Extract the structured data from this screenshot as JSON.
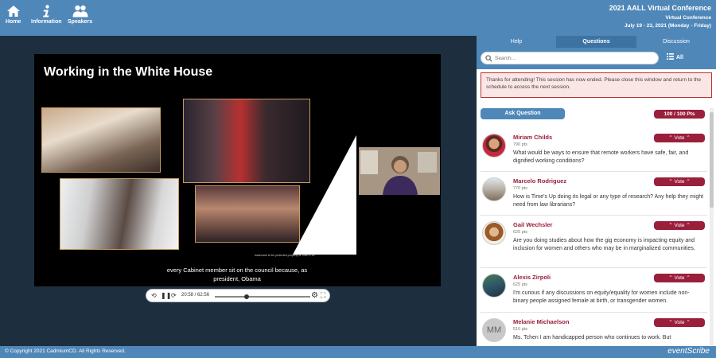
{
  "header": {
    "nav": [
      {
        "label": "Home",
        "icon": "home-icon"
      },
      {
        "label": "Information",
        "icon": "info-icon"
      },
      {
        "label": "Speakers",
        "icon": "speakers-icon"
      }
    ],
    "conference_title": "2021 AALL Virtual Conference",
    "conference_subtitle": "Virtual Conference",
    "conference_dates": "July 19 - 23, 2021 (Monday - Friday)"
  },
  "video": {
    "slide_title": "Working in the White House",
    "slide_credit": "trademark is the protected property of TIME'S UP",
    "caption": "every Cabinet member sit on the council because, as president, Obama",
    "current_time": "20:58",
    "duration": "62:56",
    "progress_fraction": 0.33
  },
  "panel": {
    "tabs": [
      {
        "label": "Help",
        "active": false
      },
      {
        "label": "Questions",
        "active": true
      },
      {
        "label": "Discussion",
        "active": false
      }
    ],
    "search_placeholder": "Search...",
    "filter_label": "All",
    "notice": "Thanks for attending! This session has now ended. Please close this window and return to the schedule to access the next session.",
    "ask_label": "Ask Question",
    "points_label": "100 / 100  Pts",
    "vote_label": "Vote",
    "questions": [
      {
        "name": "Miriam Childs",
        "pts": "790 pts",
        "text": "What would be ways to ensure that remote workers have safe, fair, and dignified working conditions?"
      },
      {
        "name": "Marcelo Rodriguez",
        "pts": "770 pts",
        "text": "How is Time's Up doing its legal or any type of research? Any help they might need from law librarians?"
      },
      {
        "name": "Gail Wechsler",
        "pts": "625 pts",
        "text": "Are you doing studies about how the gig economy is impacting equity and inclusion for women and others who may be in marginalized communities."
      },
      {
        "name": "Alexis Zirpoli",
        "pts": "625 pts",
        "text": "I'm curious if any discussions on equity/equality for women include non-binary people assigned female at birth, or transgender women."
      },
      {
        "name": "Melanie Michaelson",
        "pts": "510 pts",
        "text": "Ms. Tchen I am handicapped person who continues to work. But",
        "initials": "MM"
      }
    ]
  },
  "footer": {
    "copyright": "© Copyright 2021 CadmiumCD. All Rights Reserved.",
    "brand": "eventScribe"
  },
  "colors": {
    "header_blue": "#4f87b9",
    "stage_bg": "#1d2f3f",
    "accent_maroon": "#9a1f3b",
    "notice_border": "#bb3333"
  }
}
